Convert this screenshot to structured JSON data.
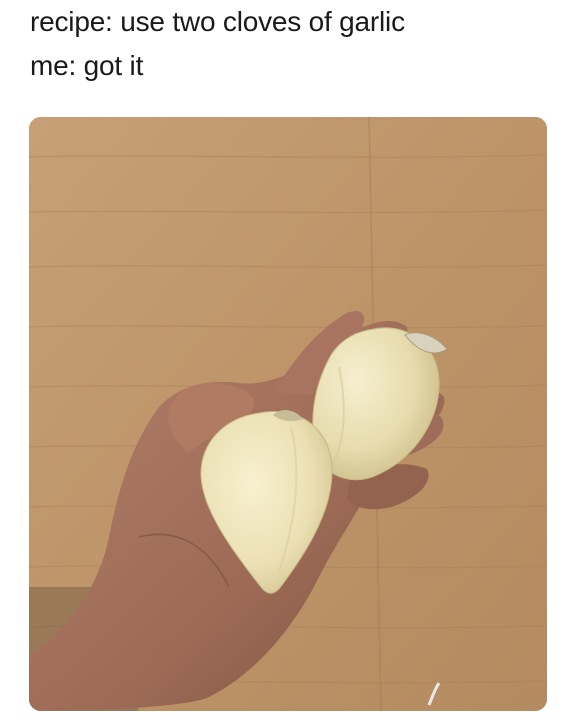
{
  "caption": {
    "line1": "recipe: use two cloves of garlic",
    "line2": "me: got it"
  },
  "photo": {
    "subject": "hand-holding-two-giant-garlic-cloves",
    "colors": {
      "wood_light": "#c9a57c",
      "wood_dark": "#a87d54",
      "skin": "#a9755c",
      "skin_shadow": "#7f5240",
      "garlic": "#ede2b8",
      "garlic_shadow": "#cdbd8a"
    }
  }
}
